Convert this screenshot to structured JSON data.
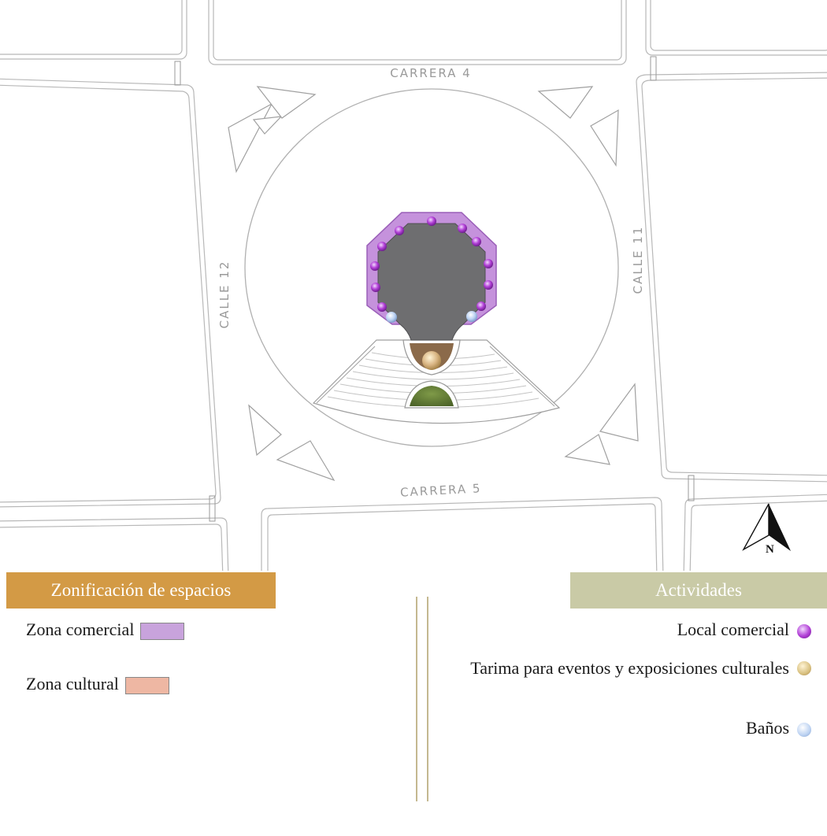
{
  "map": {
    "streets": {
      "north": "CARRERA 4",
      "south": "CARRERA 5",
      "west": "CALLE 12",
      "east": "CALLE 11"
    },
    "north_arrow_label": "N",
    "colors": {
      "commercial_zone": "#b98fcf",
      "cultural_zone": "#e8b29c",
      "building": "#6e6e70",
      "stage": "#d9b583",
      "green": "#5f7a33",
      "street_line": "#b0b0b0"
    }
  },
  "legend_zoning": {
    "title": "Zonificación de espacios",
    "title_color": "#d39a45",
    "items": [
      {
        "label": "Zona comercial",
        "color": "#c8a3dc"
      },
      {
        "label": "Zona cultural",
        "color": "#eeb7a3"
      }
    ]
  },
  "legend_activities": {
    "title": "Actividades",
    "title_color": "#c9caa6",
    "items": [
      {
        "label": "Local comercial",
        "icon": "purple-dot-icon",
        "color": "#b13fd6"
      },
      {
        "label": "Tarima para eventos y exposiciones culturales",
        "icon": "gold-dot-icon",
        "color": "#d8c07f"
      },
      {
        "label": "Baños",
        "icon": "light-blue-dot-icon",
        "color": "#bcd2f2"
      }
    ]
  }
}
